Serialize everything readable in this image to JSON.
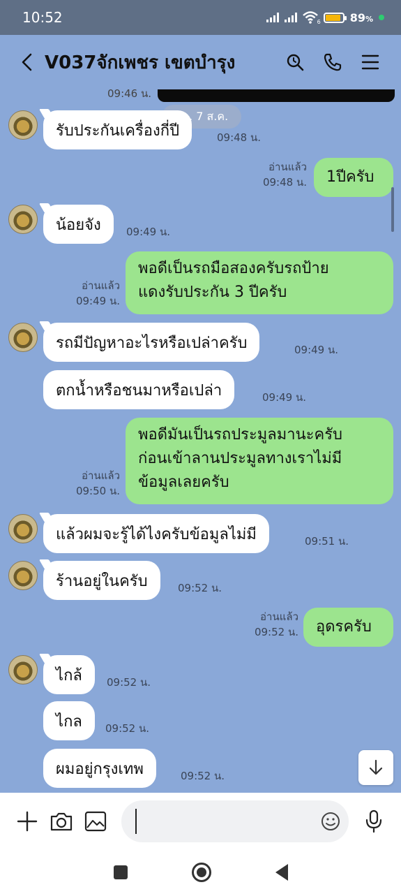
{
  "status_bar": {
    "time": "10:52",
    "battery": "89",
    "battery_unit": "%",
    "battery_level": 0.89,
    "wifi_badge": "6"
  },
  "header": {
    "title": "V037จักเพชร เขตบำรุง"
  },
  "chat": {
    "top_time": "09:46 น.",
    "date_label": "พฤ. 7 ส.ค.",
    "messages": [
      {
        "side": "in",
        "text": "รับประกันเครื่องกี่ปี",
        "time": "09:48 น."
      },
      {
        "side": "out",
        "read": "อ่านแล้ว",
        "text": "1ปีครับ",
        "time": "09:48 น."
      },
      {
        "side": "in",
        "text": "น้อยจัง",
        "time": "09:49 น."
      },
      {
        "side": "out",
        "read": "อ่านแล้ว",
        "lines": [
          "พอดีเป็นรถมือสองครับรถป้าย",
          "แดงรับประกัน 3 ปีครับ"
        ],
        "time": "09:49 น."
      },
      {
        "side": "in",
        "text": "รถมีปัญหาอะไรหรือเปล่าครับ",
        "time": "09:49 น."
      },
      {
        "side": "in",
        "text": "ตกน้ำหรือชนมาหรือเปล่า",
        "time": "09:49 น."
      },
      {
        "side": "out",
        "read": "อ่านแล้ว",
        "lines": [
          "พอดีมันเป็นรถประมูลมานะครับ",
          "ก่อนเข้าลานประมูลทางเราไม่มี",
          "ข้อมูลเลยครับ"
        ],
        "time": "09:50 น."
      },
      {
        "side": "in",
        "text": "แล้วผมจะรู้ได้ไงครับข้อมูลไม่มี",
        "time": "09:51 น."
      },
      {
        "side": "in",
        "text": "ร้านอยู่ในครับ",
        "time": "09:52 น."
      },
      {
        "side": "out",
        "read": "อ่านแล้ว",
        "text": "อุดรครับ",
        "time": "09:52 น."
      },
      {
        "side": "in",
        "text": "ไกล้",
        "time": "09:52 น."
      },
      {
        "side": "in",
        "text": "ไกล",
        "time": "09:52 น."
      },
      {
        "side": "in",
        "text": "ผมอยู่กรุงเทพ",
        "time": "09:52 น."
      }
    ]
  },
  "icons": {
    "back": "chevron-left-icon",
    "search": "search-icon",
    "call": "phone-icon",
    "menu": "menu-icon",
    "plus": "plus-icon",
    "camera": "camera-icon",
    "image": "image-icon",
    "emoji": "emoji-icon",
    "mic": "microphone-icon",
    "scroll_down": "arrow-down-icon"
  },
  "colors": {
    "background": "#8aa8d8",
    "outgoing_bubble": "#9ce48e",
    "incoming_bubble": "#ffffff",
    "status_bar": "#5f6f86"
  }
}
